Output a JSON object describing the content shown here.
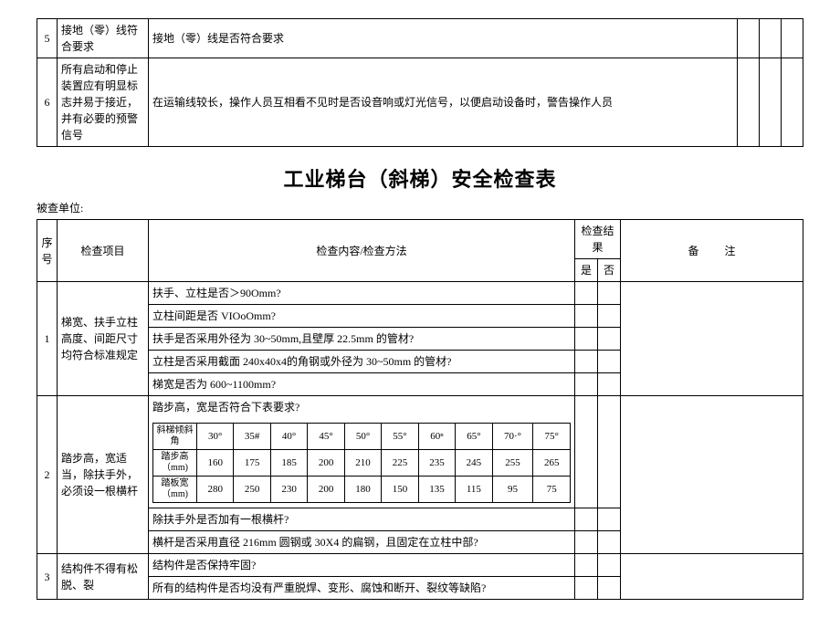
{
  "top_table": {
    "rows": [
      {
        "num": "5",
        "item": "接地（零）线符合要求",
        "method": "接地（零）线是否符合要求"
      },
      {
        "num": "6",
        "item": "所有启动和停止装置应有明显标志并易于接近，并有必要的预警信号",
        "method": "在运输线较长，操作人员互相看不见时是否设音响或灯光信号，以便启动设备时，警告操作人员"
      }
    ]
  },
  "title": "工业梯台（斜梯）安全检查表",
  "unit_label": "被查单位:",
  "headers": {
    "num": "序号",
    "item": "检查项目",
    "method": "检查内容/检查方法",
    "result": "检查结果",
    "yes": "是",
    "no": "否",
    "remark": "备注"
  },
  "rows": [
    {
      "num": "1",
      "item": "梯宽、扶手立柱高度、间距尺寸均符合标准规定",
      "methods": [
        "扶手、立柱是否＞90Omm?",
        "立柱间距是否 VIOoOmm?",
        "扶手是否采用外径为 30~50mm,且壁厚 22.5mm 的管材?",
        "立柱是否采用截面 240x40x4的角钢或外径为 30~50mm 的管材?",
        "梯宽是否为 600~1100mm?"
      ]
    },
    {
      "num": "2",
      "item": "踏步高，宽适当，除扶手外，必须设一根横杆",
      "question": "踏步高，宽是否符合下表要求?",
      "angle_table": {
        "angle_label": "斜梯倾斜角",
        "angles": [
          "30°",
          "35#",
          "40°",
          "45°",
          "50°",
          "55°",
          "60ⁿ",
          "65°",
          "70·°",
          "75°"
        ],
        "h_label": "踏步高（mm)",
        "h": [
          "160",
          "175",
          "185",
          "200",
          "210",
          "225",
          "235",
          "245",
          "255",
          "265"
        ],
        "w_label": "踏板宽（mm)",
        "w": [
          "280",
          "250",
          "230",
          "200",
          "180",
          "150",
          "135",
          "115",
          "95",
          "75"
        ]
      },
      "methods_after": [
        "除扶手外是否加有一根横杆?",
        "横杆是否采用直径 216mm 圆钢或 30X4 的扁钢，且固定在立柱中部?"
      ]
    },
    {
      "num": "3",
      "item": "结构件不得有松脱、裂",
      "methods": [
        "结构件是否保持牢固?",
        "所有的结构件是否均没有严重脱焊、变形、腐蚀和断开、裂纹等缺陷?"
      ]
    }
  ]
}
